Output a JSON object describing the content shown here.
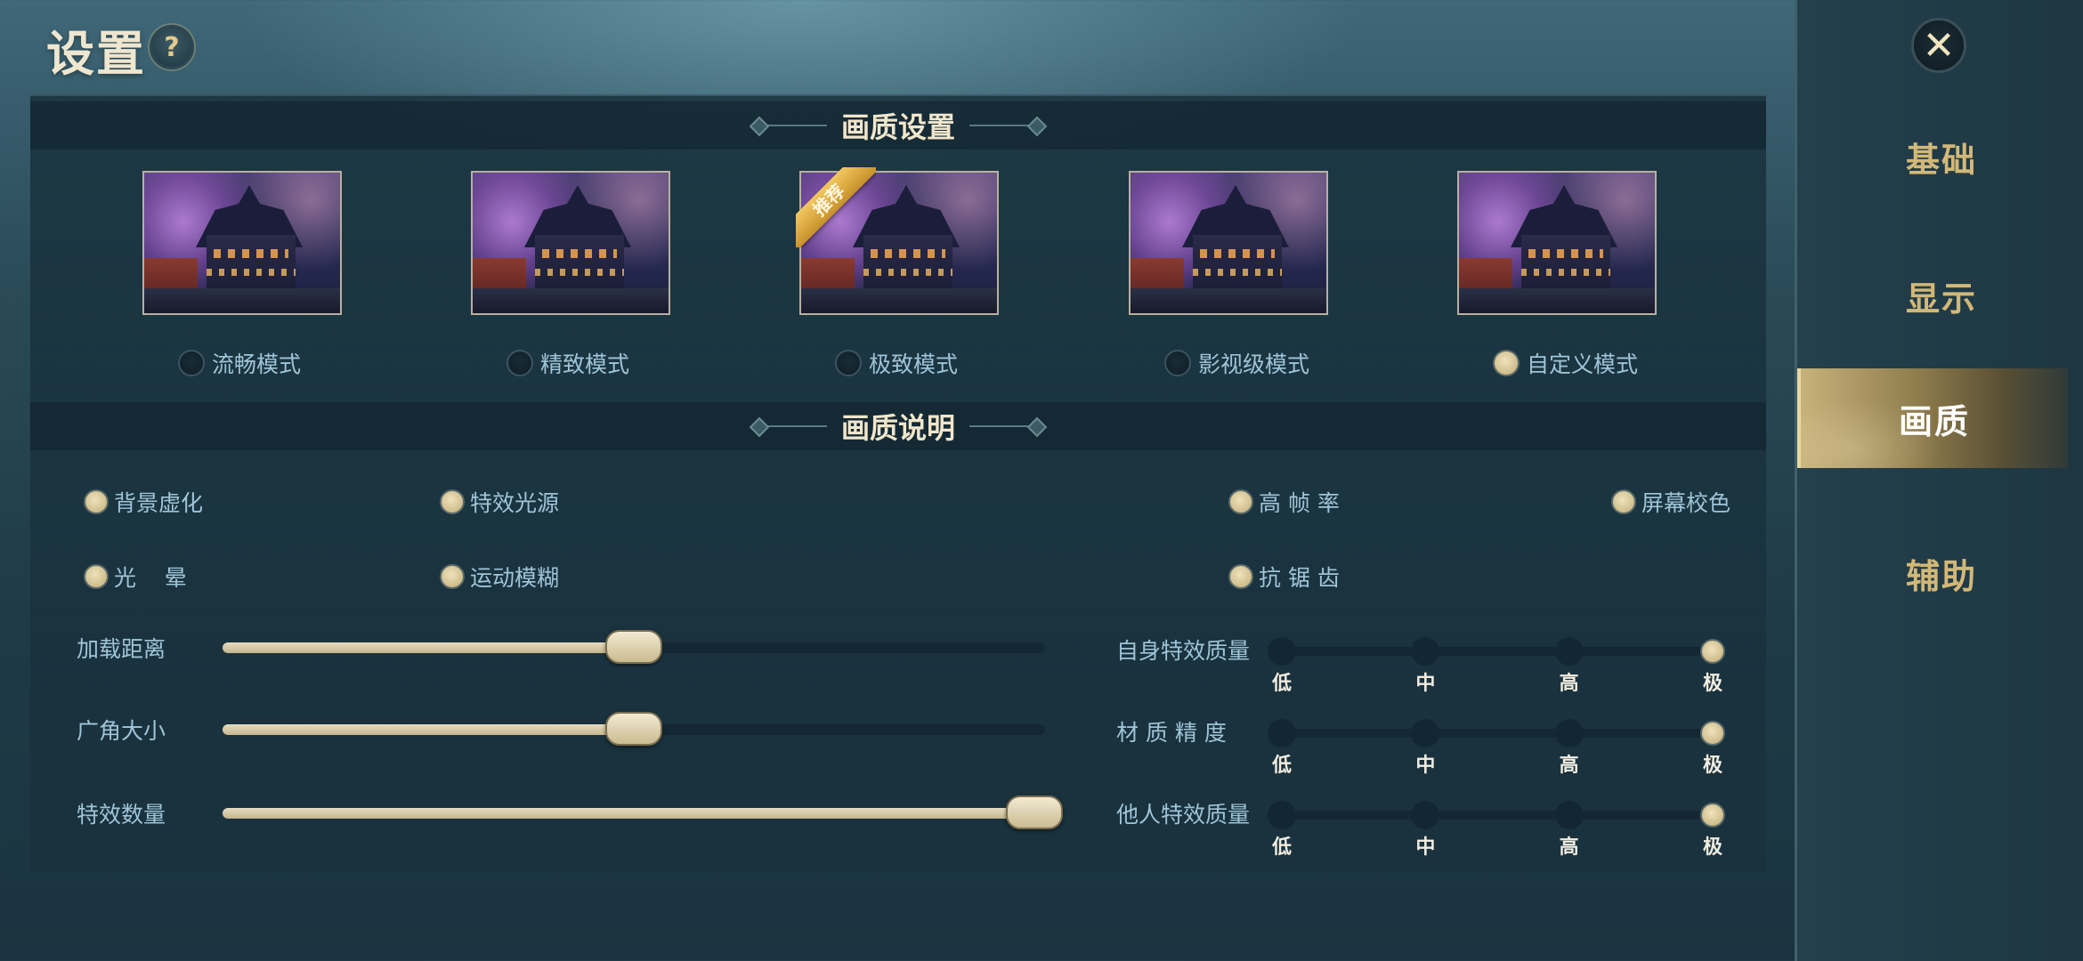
{
  "header": {
    "title": "设置",
    "help_icon": "?"
  },
  "sidebar": {
    "close_icon": "✕",
    "items": [
      {
        "label": "基础",
        "active": false
      },
      {
        "label": "显示",
        "active": false
      },
      {
        "label": "画质",
        "active": true
      },
      {
        "label": "辅助",
        "active": false
      }
    ]
  },
  "quality_settings": {
    "section_title": "画质设置",
    "badge": "推荐",
    "modes": [
      {
        "label": "流畅模式",
        "selected": false
      },
      {
        "label": "精致模式",
        "selected": false
      },
      {
        "label": "极致模式",
        "selected": false,
        "recommended": true
      },
      {
        "label": "影视级模式",
        "selected": false
      },
      {
        "label": "自定义模式",
        "selected": true
      }
    ]
  },
  "quality_details": {
    "section_title": "画质说明",
    "toggles": [
      {
        "label": "背景虚化",
        "on": true
      },
      {
        "label": "特效光源",
        "on": true
      },
      {
        "label": "高 帧 率",
        "on": true
      },
      {
        "label": "屏幕校色",
        "on": true
      },
      {
        "label": "光    晕",
        "on": true
      },
      {
        "label": "运动模糊",
        "on": true
      },
      {
        "label": "抗 锯 齿",
        "on": true
      }
    ],
    "sliders": [
      {
        "label": "加载距离",
        "value": 0.5
      },
      {
        "label": "广角大小",
        "value": 0.5
      },
      {
        "label": "特效数量",
        "value": 1.0
      }
    ],
    "step_levels": [
      "低",
      "中",
      "高",
      "极"
    ],
    "steps": [
      {
        "label": "自身特效质量",
        "selected": "极"
      },
      {
        "label": "材 质 精 度",
        "selected": "极"
      },
      {
        "label": "他人特效质量",
        "selected": "极"
      }
    ]
  },
  "colors": {
    "accent_gold": "#cfbd8c",
    "label_blue": "#9fc4d8",
    "nav_gold": "#d2b878"
  }
}
